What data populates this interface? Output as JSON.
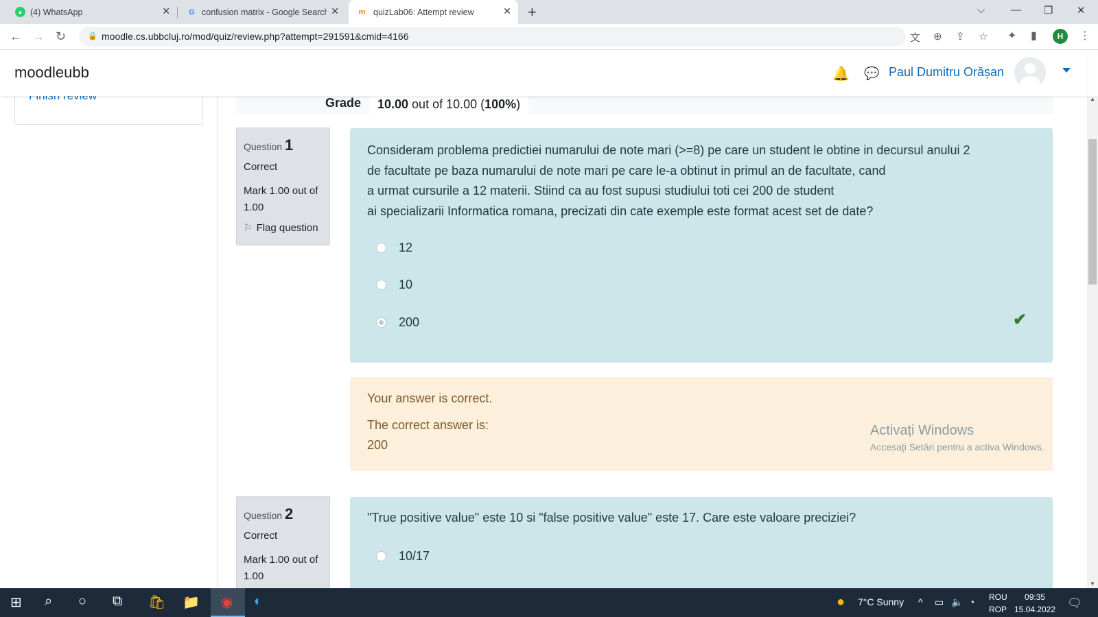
{
  "browser": {
    "tabs": [
      {
        "title": "(4) WhatsApp",
        "icon": "whatsapp-icon"
      },
      {
        "title": "confusion matrix - Google Search",
        "icon": "google-icon"
      },
      {
        "title": "quizLab06: Attempt review",
        "icon": "moodle-icon"
      }
    ],
    "url": "moodle.cs.ubbcluj.ro/mod/quiz/review.php?attempt=291591&cmid=4166",
    "profile_initial": "H"
  },
  "navbar": {
    "brand": "moodleubb",
    "user_name": "Paul Dumitru Orășan"
  },
  "sidebar": {
    "finish_review": "Finish review"
  },
  "grade": {
    "label": "Grade",
    "score": "10.00",
    "out_of": " out of 10.00 (",
    "percent": "100%",
    "close": ")"
  },
  "questions": [
    {
      "label": "Question",
      "number": "1",
      "state": "Correct",
      "mark": "Mark 1.00 out of 1.00",
      "flag": "Flag question",
      "text_lines": [
        "Consideram problema predictiei numarului de note mari (>=8) pe care un student le obtine in decursul anului 2",
        "de facultate pe baza numarului de note mari pe care le-a obtinut in primul an de facultate, cand",
        "a urmat cursurile a 12 materii. Stiind ca au fost supusi studiului toti cei 200 de student",
        "ai specializarii Informatica romana, precizati din cate exemple este format acest set de date?"
      ],
      "options": [
        "12",
        "10",
        "200"
      ],
      "selected": "200",
      "feedback": {
        "result": "Your answer is correct.",
        "correct_label": "The correct answer is:",
        "correct_value": "200"
      }
    },
    {
      "label": "Question",
      "number": "2",
      "state": "Correct",
      "mark": "Mark 1.00 out of 1.00",
      "text": "\"True positive value\" este 10 si \"false positive value\" este 17. Care este valoare preciziei?",
      "options": [
        "10/17"
      ]
    }
  ],
  "watermark": {
    "title": "Activați Windows",
    "subtitle": "Accesați Setări pentru a activa Windows."
  },
  "taskbar": {
    "weather": "7°C  Sunny",
    "lang_top": "ROU",
    "lang_bottom": "ROP",
    "time": "09:35",
    "date": "15.04.2022"
  }
}
